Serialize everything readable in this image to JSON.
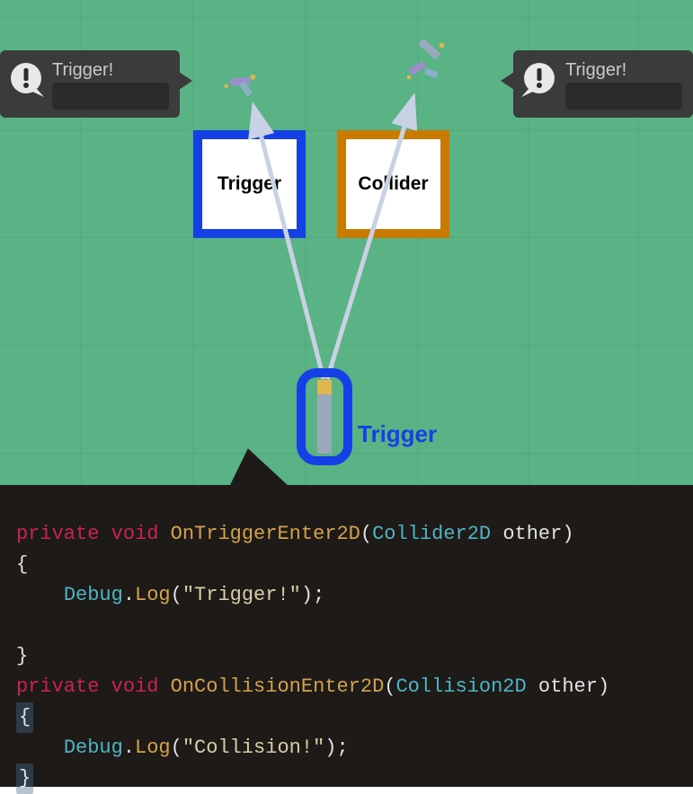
{
  "bubbles": {
    "left": {
      "title": "Trigger!"
    },
    "right": {
      "title": "Trigger!"
    }
  },
  "boxes": {
    "trigger": "Trigger",
    "collider": "Collider"
  },
  "bullet": {
    "label": "Trigger"
  },
  "code": {
    "kw_private1": "private",
    "kw_void1": "void",
    "fn1": "OnTriggerEnter2D",
    "type1": "Collider2D",
    "param1": "other",
    "brace_open1": "{",
    "debug": "Debug",
    "dot": ".",
    "log": "Log",
    "paren_open": "(",
    "str1": "\"Trigger!\"",
    "paren_close_semi": ");",
    "brace_close1": "}",
    "kw_private2": "private",
    "kw_void2": "void",
    "fn2": "OnCollisionEnter2D",
    "type2": "Collision2D",
    "param2": "other",
    "brace_open2": "{",
    "str2": "\"Collision!\"",
    "brace_close2": "}"
  },
  "colors": {
    "scene_bg": "#59b384",
    "trigger_border": "#1540e6",
    "collider_border": "#c87b00",
    "code_bg": "#1d1a17"
  }
}
